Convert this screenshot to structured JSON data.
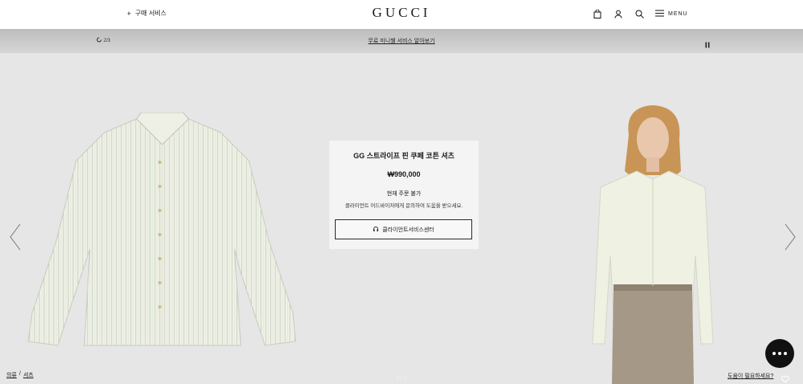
{
  "header": {
    "client_service_label": "구매 서비스",
    "logo": "GUCCI",
    "menu_label": "MENU",
    "icons": [
      "shopping-bag-icon",
      "user-icon",
      "search-icon",
      "hamburger-icon"
    ]
  },
  "promo": {
    "counter": "2/3",
    "link_text": "무료 미니쉘 서비스 알아보기"
  },
  "product": {
    "name": "GG 스트라이프 핀 쿠페 코튼 셔츠",
    "price": "₩990,000",
    "status": "현재 주문 불가",
    "note": "클라이언트 어드바이저에게 문의하여 도움을 받으세요.",
    "cta_label": "클라이언트서비스센터"
  },
  "breadcrumb": [
    "의류",
    "셔츠"
  ],
  "slide_index": "2 / 7",
  "help_label": "도움이 필요하세요?",
  "colors": {
    "background": "#e7e7e7",
    "card": "#f4f4f4",
    "text": "#1b1b1b",
    "chat": "#111111"
  }
}
